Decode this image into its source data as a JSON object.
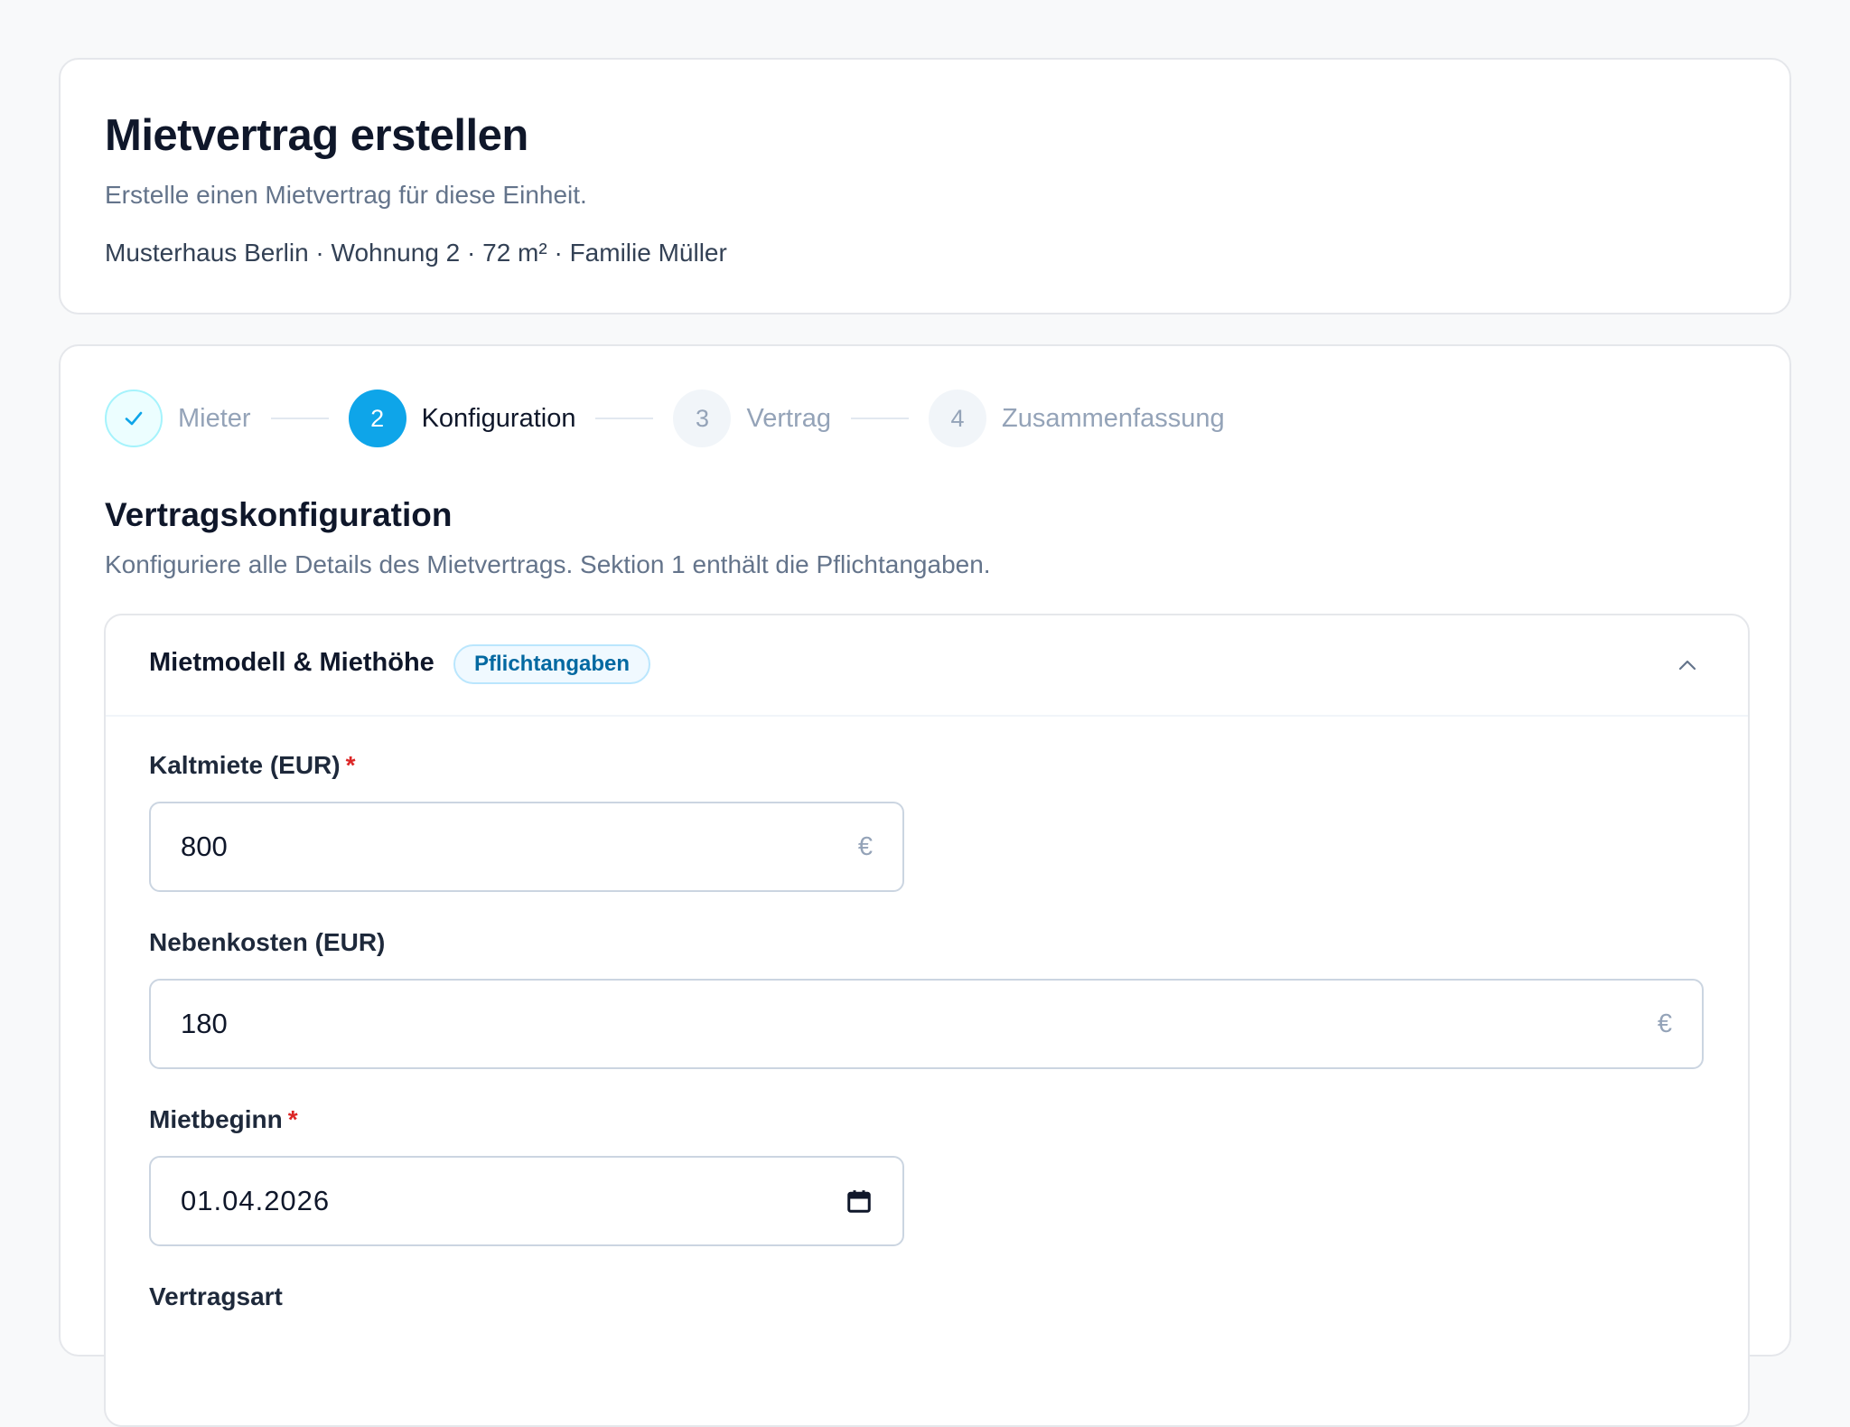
{
  "header": {
    "title": "Mietvertrag erstellen",
    "subtitle": "Erstelle einen Mietvertrag für diese Einheit.",
    "context": "Musterhaus Berlin · Wohnung 2 · 72 m² · Familie Müller"
  },
  "stepper": {
    "steps": [
      {
        "number": "✓",
        "label": "Mieter",
        "state": "done"
      },
      {
        "number": "2",
        "label": "Konfiguration",
        "state": "active"
      },
      {
        "number": "3",
        "label": "Vertrag",
        "state": "pending"
      },
      {
        "number": "4",
        "label": "Zusammenfassung",
        "state": "pending"
      }
    ]
  },
  "section": {
    "title": "Vertragskonfiguration",
    "description": "Konfiguriere alle Details des Mietvertrags. Sektion 1 enthält die Pflichtangaben."
  },
  "accordion": {
    "title": "Mietmodell & Miethöhe",
    "badge": "Pflichtangaben",
    "expanded": true,
    "chevron_icon": "chevron-up-icon"
  },
  "fields": {
    "kaltmiete": {
      "label": "Kaltmiete (EUR)",
      "required_mark": "*",
      "value": "800",
      "suffix": "€"
    },
    "nebenkosten": {
      "label": "Nebenkosten (EUR)",
      "value": "180",
      "suffix": "€"
    },
    "mietbeginn": {
      "label": "Mietbeginn",
      "required_mark": "*",
      "value": "01.04.2026",
      "icon": "calendar-icon"
    },
    "vertragsart": {
      "label": "Vertragsart"
    }
  },
  "colors": {
    "accent": "#0ea5e9",
    "required": "#dc2626",
    "badge_text": "#0369a1"
  }
}
